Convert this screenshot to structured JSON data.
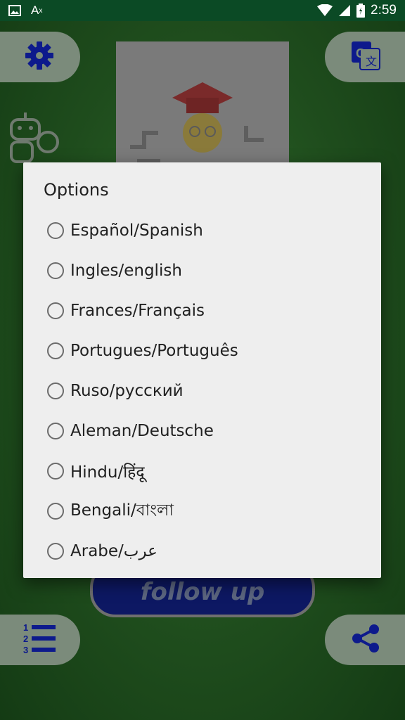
{
  "status_bar": {
    "time": "2:59",
    "icons": [
      "image-icon",
      "text-format-icon",
      "wifi-icon",
      "signal-icon",
      "battery-icon"
    ]
  },
  "app": {
    "follow_button_label": "follow up",
    "buttons": {
      "settings": "gear-icon",
      "translate": "translate-icon",
      "list": "numbered-list-icon",
      "share": "share-icon",
      "robot": "robot-icon"
    },
    "colors": {
      "accent": "#0d1a8c",
      "background": "#2a5f28",
      "dialog_bg": "#eeeeee"
    }
  },
  "dialog": {
    "title": "Options",
    "options": [
      {
        "label": "Español/Spanish",
        "selected": false
      },
      {
        "label": "Ingles/english",
        "selected": false
      },
      {
        "label": "Frances/Français",
        "selected": false
      },
      {
        "label": "Portugues/Português",
        "selected": false
      },
      {
        "label": "Ruso/русский",
        "selected": false
      },
      {
        "label": "Aleman/Deutsche",
        "selected": false
      },
      {
        "label": "Hindu/हिंदू",
        "selected": false
      },
      {
        "label": "Bengali/বাংলা",
        "selected": false
      },
      {
        "label": "Arabe/عرب",
        "selected": false
      }
    ]
  }
}
